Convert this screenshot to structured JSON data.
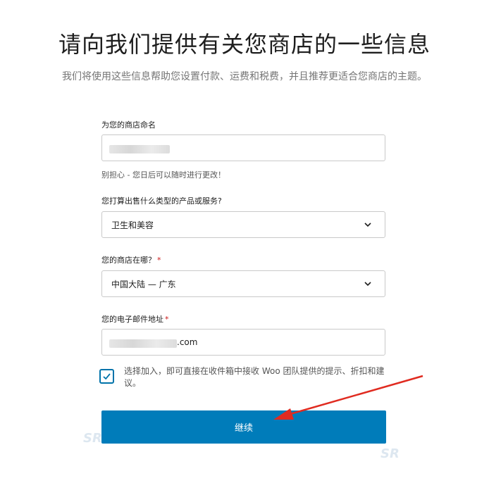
{
  "header": {
    "title": "请向我们提供有关您商店的一些信息",
    "subtitle": "我们将使用这些信息帮助您设置付款、运费和税费，并且推荐更适合您商店的主题。"
  },
  "form": {
    "store_name": {
      "label": "为您的商店命名",
      "help": "别担心 - 您日后可以随时进行更改！"
    },
    "product_type": {
      "label": "您打算出售什么类型的产品或服务?",
      "selected": "卫生和美容"
    },
    "location": {
      "label": "您的商店在哪？",
      "required_mark": "*",
      "selected": "中国大陆 — 广东"
    },
    "email": {
      "label": "您的电子邮件地址",
      "required_mark": "*",
      "visible_suffix": ".com"
    },
    "opt_in": {
      "checked": true,
      "label": "选择加入，即可直接在收件箱中接收 Woo 团队提供的提示、折扣和建议。"
    },
    "continue_label": "继续"
  },
  "colors": {
    "primary": "#007cba",
    "required": "#cc1818",
    "arrow": "#e02b20"
  },
  "icons": {
    "select_chevron": "chevron-down-icon",
    "checkbox_mark": "checkmark-icon"
  }
}
